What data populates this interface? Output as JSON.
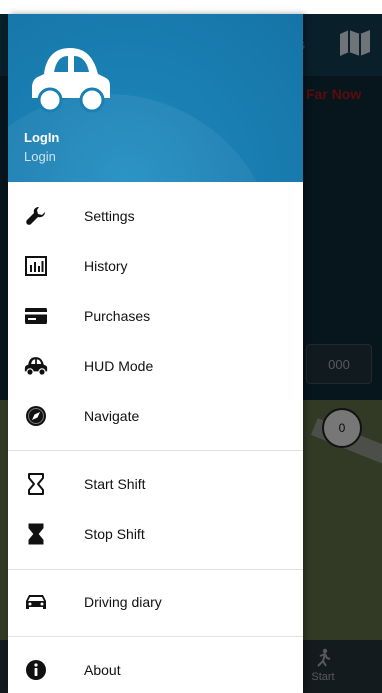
{
  "background_app": {
    "toolbar_partial_text": "s",
    "red_partial_text": "Far Now",
    "box_value": "000",
    "circle_value": "0",
    "bottom_start_label": "Start"
  },
  "header": {
    "name": "LogIn",
    "subtitle": "Login"
  },
  "menu": {
    "items": [
      {
        "label": "Settings",
        "icon": "wrench-icon"
      },
      {
        "label": "History",
        "icon": "bar-chart-icon"
      },
      {
        "label": "Purchases",
        "icon": "credit-card-icon"
      },
      {
        "label": "HUD Mode",
        "icon": "car-icon"
      },
      {
        "label": "Navigate",
        "icon": "compass-icon"
      },
      {
        "label": "Start Shift",
        "icon": "hourglass-empty-icon"
      },
      {
        "label": "Stop Shift",
        "icon": "hourglass-full-icon"
      },
      {
        "label": "Driving diary",
        "icon": "car-front-icon"
      },
      {
        "label": "About",
        "icon": "info-icon"
      }
    ]
  },
  "colors": {
    "header_blue": "#1a80b4",
    "accent_red": "#a2161a"
  }
}
